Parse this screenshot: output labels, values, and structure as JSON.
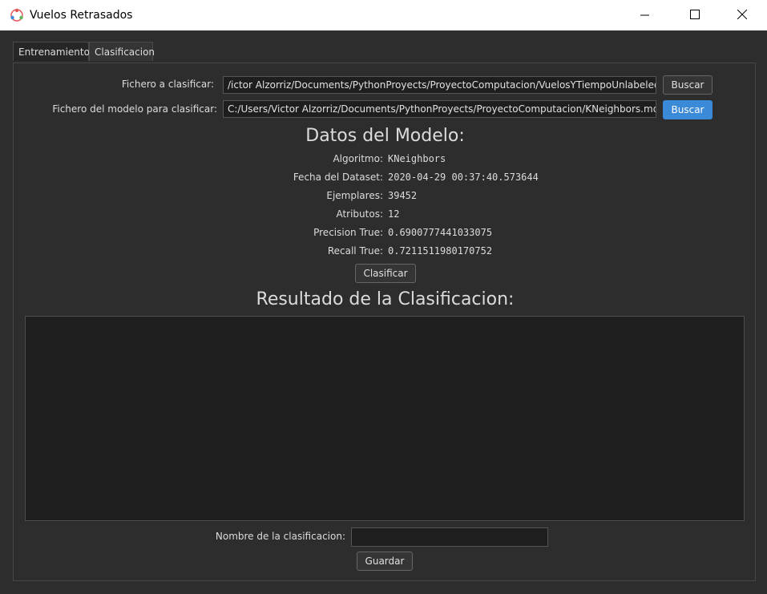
{
  "window": {
    "title": "Vuelos Retrasados"
  },
  "tabs": [
    {
      "label": "Entrenamiento",
      "active": false
    },
    {
      "label": "Clasificacion",
      "active": true
    }
  ],
  "files": {
    "classify_label": "Fichero a clasificar:",
    "classify_path": "/ictor Alzorriz/Documents/PythonProyects/ProyectoComputacion/VuelosYTiempoUnlabeled.csv",
    "classify_button": "Buscar",
    "model_label": "Fichero del modelo para clasificar:",
    "model_path": "C:/Users/Victor Alzorriz/Documents/PythonProyects/ProyectoComputacion/KNeighbors.mdl",
    "model_button": "Buscar"
  },
  "model": {
    "heading": "Datos del Modelo:",
    "rows": [
      {
        "label": "Algoritmo:",
        "value": "KNeighbors"
      },
      {
        "label": "Fecha del Dataset:",
        "value": "2020-04-29 00:37:40.573644"
      },
      {
        "label": "Ejemplares:",
        "value": "39452"
      },
      {
        "label": "Atributos:",
        "value": "12"
      },
      {
        "label": "Precision True:",
        "value": "0.6900777441033075"
      },
      {
        "label": "Recall True:",
        "value": "0.7211511980170752"
      }
    ],
    "classify_button": "Clasificar"
  },
  "result": {
    "heading": "Resultado de la Clasificacion:",
    "name_label": "Nombre de la clasificacion:",
    "name_value": "",
    "save_button": "Guardar"
  },
  "colors": {
    "accent": "#3b8ad8",
    "background": "#2d2d2d"
  }
}
